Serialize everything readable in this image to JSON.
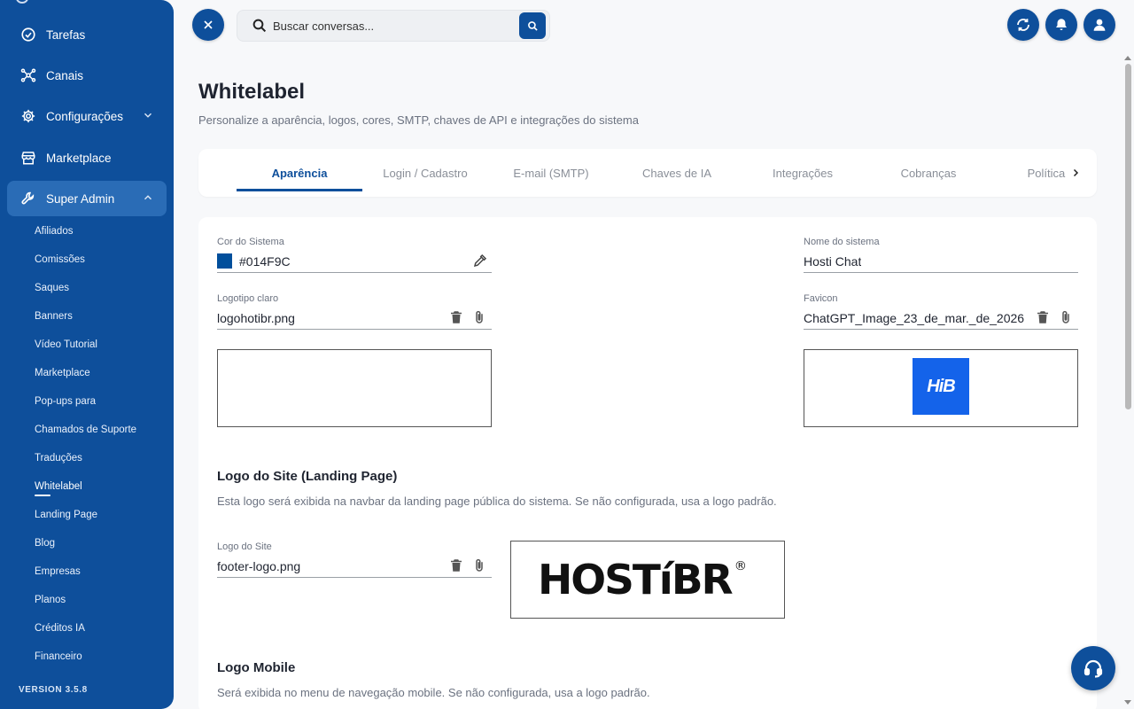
{
  "sidebar": {
    "main_items": [
      {
        "label": "Tarefas",
        "icon": "check-circle-icon"
      },
      {
        "label": "Canais",
        "icon": "network-icon"
      },
      {
        "label": "Configurações",
        "icon": "gear-icon"
      },
      {
        "label": "Marketplace",
        "icon": "store-icon"
      },
      {
        "label": "Super Admin",
        "icon": "wrench-icon"
      }
    ],
    "sub_items": [
      "Afiliados",
      "Comissões",
      "Saques",
      "Banners",
      "Vídeo Tutorial",
      "Marketplace",
      "Pop-ups para",
      "Chamados de Suporte",
      "Traduções",
      "Whitelabel",
      "Landing Page",
      "Blog",
      "Empresas",
      "Planos",
      "Créditos IA",
      "Financeiro"
    ],
    "current_sub": "Whitelabel",
    "version": "VERSION 3.5.8"
  },
  "topbar": {
    "search_placeholder": "Buscar conversas..."
  },
  "page": {
    "title": "Whitelabel",
    "subtitle": "Personalize a aparência, logos, cores, SMTP, chaves de API e integrações do sistema"
  },
  "tabs": [
    {
      "label": "Aparência",
      "active": true
    },
    {
      "label": "Login / Cadastro",
      "active": false
    },
    {
      "label": "E-mail (SMTP)",
      "active": false
    },
    {
      "label": "Chaves de IA",
      "active": false
    },
    {
      "label": "Integrações",
      "active": false
    },
    {
      "label": "Cobranças",
      "active": false
    },
    {
      "label": "Política de",
      "active": false
    }
  ],
  "form": {
    "system_color": {
      "label": "Cor do Sistema",
      "value": "#014F9C"
    },
    "system_name": {
      "label": "Nome do sistema",
      "value": "Hosti Chat"
    },
    "logo_light": {
      "label": "Logotipo claro",
      "value": "logohotibr.png"
    },
    "favicon": {
      "label": "Favicon",
      "value": "ChatGPT_Image_23_de_mar._de_2026",
      "preview_text": "HiB"
    },
    "site_logo_section": {
      "title": "Logo do Site (Landing Page)",
      "desc": "Esta logo será exibida na navbar da landing page pública do sistema. Se não configurada, usa a logo padrão."
    },
    "site_logo": {
      "label": "Logo do Site",
      "value": "footer-logo.png",
      "preview_text": "HOSTíBR",
      "preview_mark": "®"
    },
    "mobile_logo_section": {
      "title": "Logo Mobile",
      "desc": "Será exibida no menu de navegação mobile. Se não configurada, usa a logo padrão."
    }
  },
  "colors": {
    "primary": "#0e4f9b",
    "favicon_bg": "#1463ea",
    "swatch": "#014F9C"
  }
}
